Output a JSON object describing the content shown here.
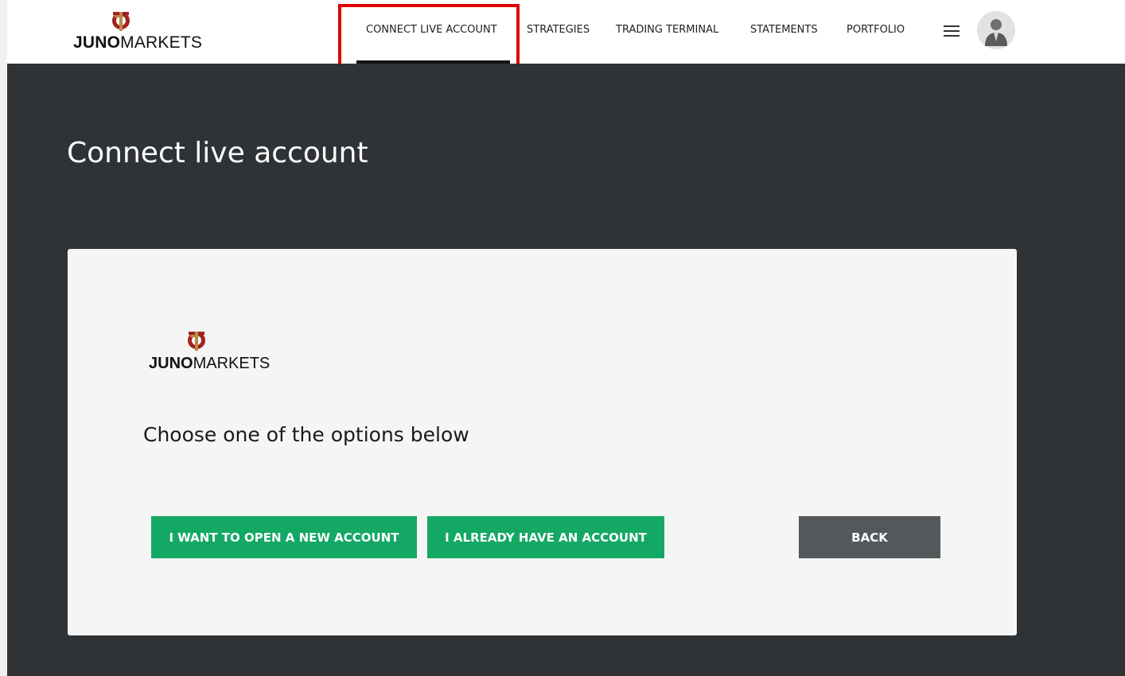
{
  "brand": {
    "name_strong": "JUNO",
    "name_rest": "MARKETS",
    "colors": {
      "mark": "#a3221f",
      "mark_accent": "#b88a4a",
      "text": "#111111"
    }
  },
  "nav": {
    "items": [
      {
        "label": "CONNECT LIVE ACCOUNT",
        "active": true
      },
      {
        "label": "STRATEGIES",
        "active": false
      },
      {
        "label": "TRADING TERMINAL",
        "active": false
      },
      {
        "label": "STATEMENTS",
        "active": false
      },
      {
        "label": "PORTFOLIO",
        "active": false
      }
    ],
    "menu_icon": "hamburger-menu-icon",
    "avatar_icon": "user-avatar-icon",
    "highlight_color": "#e00000"
  },
  "page": {
    "title": "Connect live account",
    "background": "#303336"
  },
  "card": {
    "instruction": "Choose one of the options below",
    "buttons": {
      "open_new": "I WANT TO OPEN A NEW ACCOUNT",
      "already_have": "I ALREADY HAVE AN ACCOUNT",
      "back": "BACK"
    },
    "colors": {
      "primary": "#14a865",
      "secondary": "#55585b",
      "card_bg": "#f5f5f5"
    }
  }
}
